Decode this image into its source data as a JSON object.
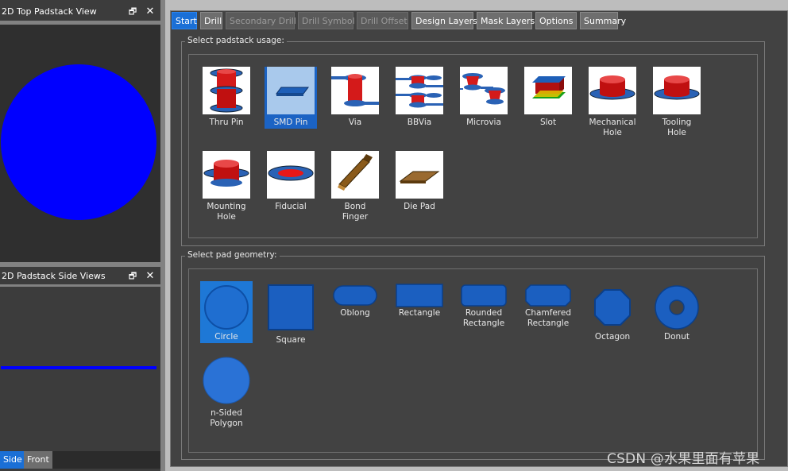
{
  "left": {
    "top_view_title": "2D Top Padstack View",
    "side_view_title": "2D Padstack Side Views",
    "side_tabs": [
      "Side",
      "Front"
    ],
    "pad_color": "#0000ff"
  },
  "tabs": [
    {
      "label": "Start",
      "state": "active"
    },
    {
      "label": "Drill",
      "state": "normal"
    },
    {
      "label": "Secondary Drill",
      "state": "disabled"
    },
    {
      "label": "Drill Symbol",
      "state": "disabled"
    },
    {
      "label": "Drill Offset",
      "state": "disabled"
    },
    {
      "label": "Design Layers",
      "state": "normal"
    },
    {
      "label": "Mask Layers",
      "state": "normal"
    },
    {
      "label": "Options",
      "state": "normal"
    },
    {
      "label": "Summary",
      "state": "normal"
    }
  ],
  "usage": {
    "group_label": "Select padstack usage:",
    "selected": "SMD Pin",
    "items": [
      {
        "label": "Thru Pin",
        "icon": "thru-pin-icon"
      },
      {
        "label": "SMD Pin",
        "icon": "smd-pin-icon"
      },
      {
        "label": "Via",
        "icon": "via-icon"
      },
      {
        "label": "BBVia",
        "icon": "bbvia-icon"
      },
      {
        "label": "Microvia",
        "icon": "microvia-icon"
      },
      {
        "label": "Slot",
        "icon": "slot-icon"
      },
      {
        "label": "Mechanical Hole",
        "icon": "mechanical-hole-icon"
      },
      {
        "label": "Tooling Hole",
        "icon": "tooling-hole-icon"
      },
      {
        "label": "Mounting Hole",
        "icon": "mounting-hole-icon"
      },
      {
        "label": "Fiducial",
        "icon": "fiducial-icon"
      },
      {
        "label": "Bond Finger",
        "icon": "bond-finger-icon"
      },
      {
        "label": "Die Pad",
        "icon": "die-pad-icon"
      }
    ]
  },
  "geometry": {
    "group_label": "Select pad geometry:",
    "selected": "Circle",
    "items": [
      {
        "label": "Circle",
        "icon": "circle-pad-icon"
      },
      {
        "label": "Square",
        "icon": "square-pad-icon"
      },
      {
        "label": "Oblong",
        "icon": "oblong-pad-icon"
      },
      {
        "label": "Rectangle",
        "icon": "rectangle-pad-icon"
      },
      {
        "label": "Rounded Rectangle",
        "icon": "rounded-rectangle-pad-icon"
      },
      {
        "label": "Chamfered Rectangle",
        "icon": "chamfered-rectangle-pad-icon"
      },
      {
        "label": "Octagon",
        "icon": "octagon-pad-icon"
      },
      {
        "label": "Donut",
        "icon": "donut-pad-icon"
      },
      {
        "label": "n-Sided Polygon",
        "icon": "n-sided-polygon-pad-icon"
      }
    ]
  },
  "watermark": "CSDN @水果里面有苹果"
}
